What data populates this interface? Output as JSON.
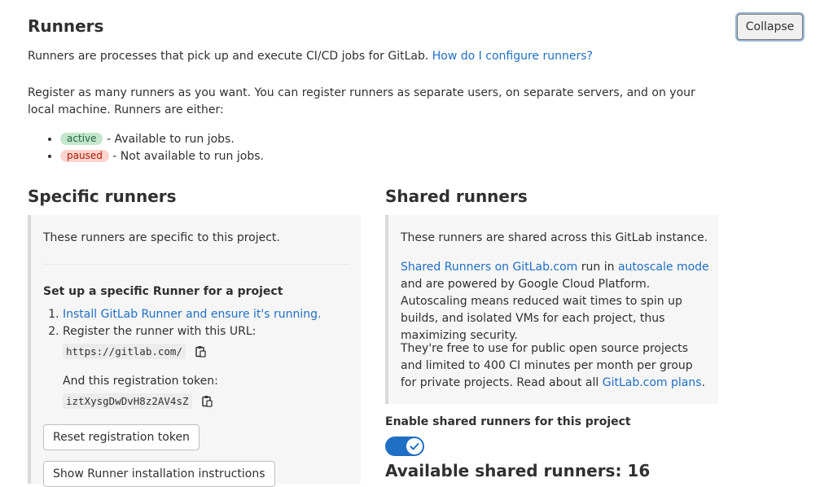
{
  "header": {
    "title": "Runners",
    "collapse_label": "Collapse"
  },
  "intro": {
    "text": "Runners are processes that pick up and execute CI/CD jobs for GitLab.",
    "link": "How do I configure runners?"
  },
  "register_text": "Register as many runners as you want. You can register runners as separate users, on separate servers, and on your local machine. Runners are either:",
  "states": [
    {
      "badge": "active",
      "text": "- Available to run jobs.",
      "color": "#c3e6cd"
    },
    {
      "badge": "paused",
      "text": "- Not available to run jobs.",
      "color": "#fdd4cd"
    }
  ],
  "specific": {
    "title": "Specific runners",
    "description": "These runners are specific to this project.",
    "setup_title": "Set up a specific Runner for a project",
    "step1_link": "Install GitLab Runner and ensure it's running.",
    "step2_text": "Register the runner with this URL:",
    "url": "https://gitlab.com/",
    "token_label": "And this registration token:",
    "token": "iztXysgDwDvH8z2AV4sZ",
    "reset_button": "Reset registration token",
    "show_button": "Show Runner installation instructions"
  },
  "shared": {
    "title": "Shared runners",
    "description": "These runners are shared across this GitLab instance.",
    "link1": "Shared Runners on GitLab.com",
    "text1": "run in",
    "link2": "autoscale mode",
    "text2": "and are powered by Google Cloud Platform. Autoscaling means reduced wait times to spin up builds, and isolated VMs for each project, thus maximizing security.",
    "text3": "They're free to use for public open source projects and limited to 400 CI minutes per month per group for private projects. Read about all",
    "link3": "GitLab.com plans",
    "text3_end": ".",
    "toggle_label": "Enable shared runners for this project",
    "toggle_on": true,
    "available_title": "Available shared runners: 16"
  },
  "colors": {
    "link": "#1f6fc5",
    "toggle": "#1f6fc5"
  },
  "icons": {
    "copy": "clipboard-icon",
    "toggle_check": "check-icon"
  }
}
